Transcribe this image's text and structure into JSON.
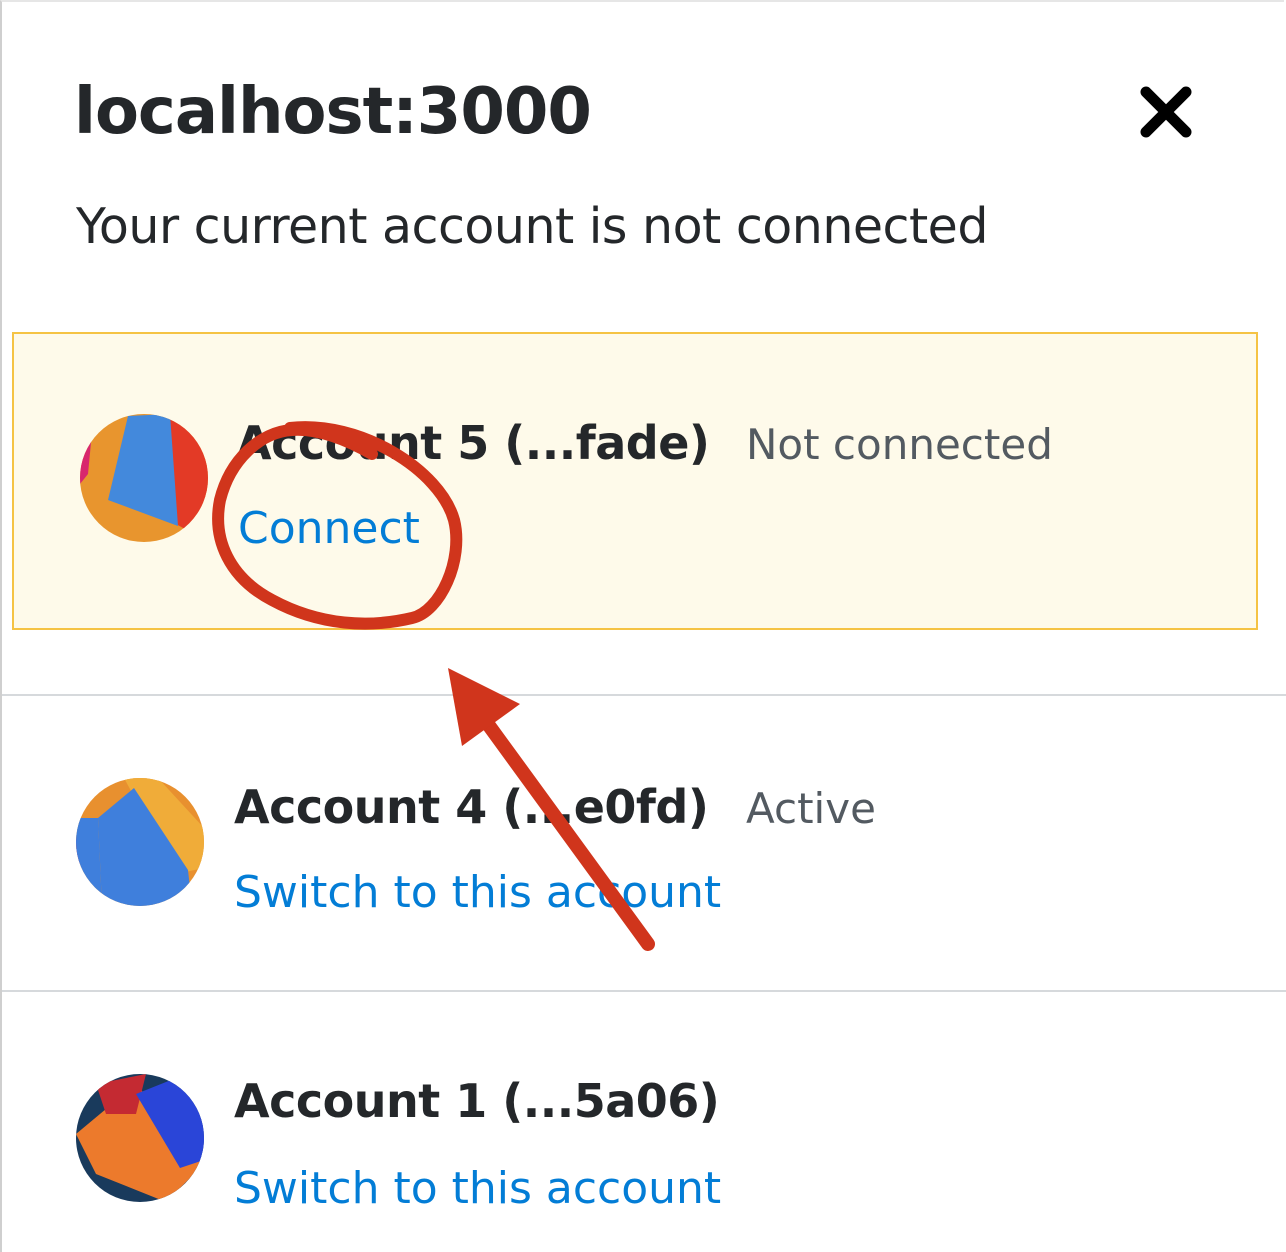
{
  "header": {
    "site": "localhost:3000",
    "close_icon": "close-icon",
    "status": "Your current account is not connected"
  },
  "accounts": [
    {
      "name": "Account 5 (...fade)",
      "status": "Not connected",
      "action": "Connect",
      "highlighted": true,
      "avatar_icon": "jazzicon-avatar"
    },
    {
      "name": "Account 4 (...e0fd)",
      "status": "Active",
      "action": "Switch to this account",
      "highlighted": false,
      "avatar_icon": "jazzicon-avatar"
    },
    {
      "name": "Account 1 (...5a06)",
      "status": "",
      "action": "Switch to this account",
      "highlighted": false,
      "avatar_icon": "jazzicon-avatar"
    }
  ],
  "colors": {
    "link": "#037dd6",
    "highlight_bg": "#fefaea",
    "highlight_border": "#f5c344",
    "annotation": "#d0351c"
  }
}
